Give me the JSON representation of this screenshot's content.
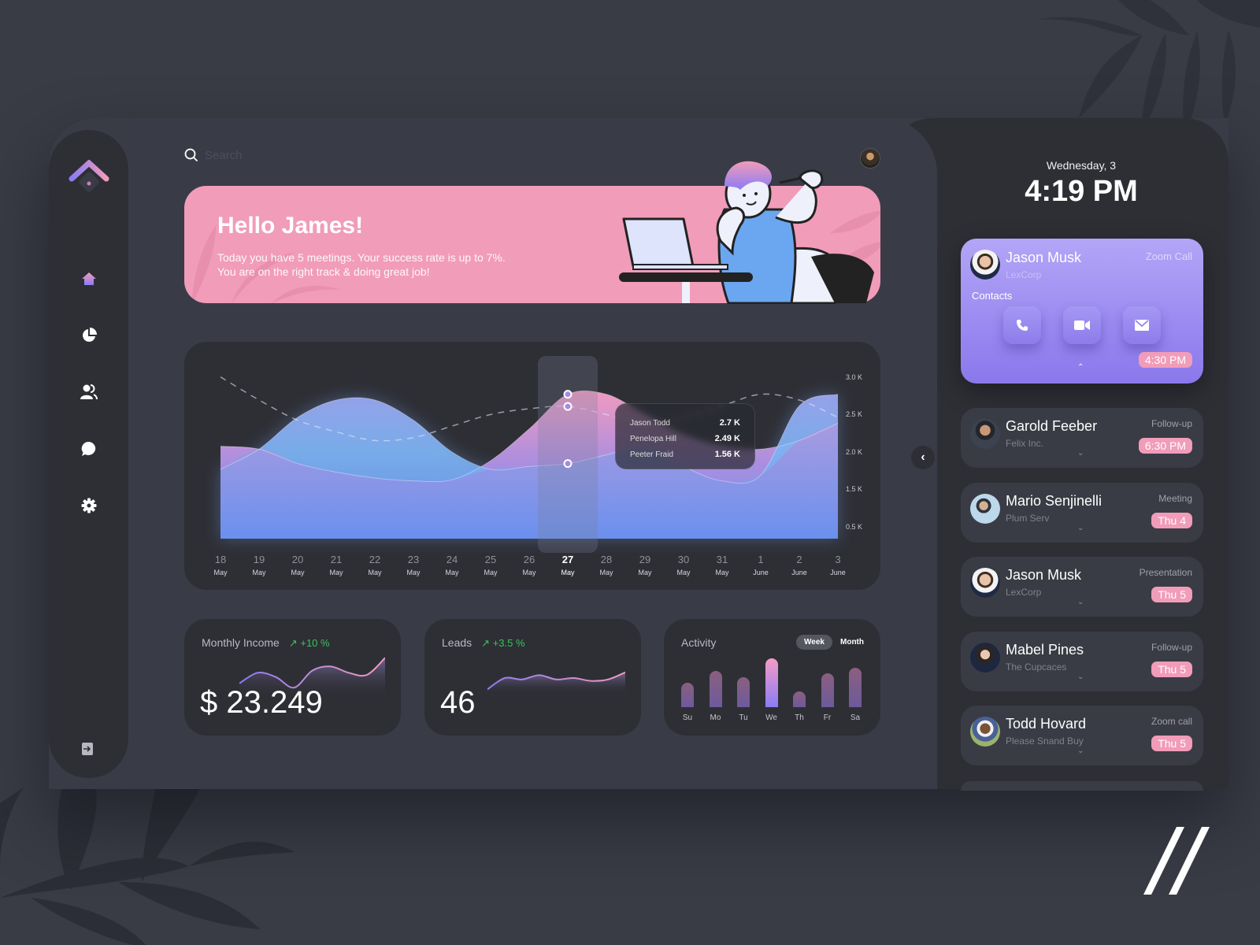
{
  "search": {
    "placeholder": "Search",
    "value": ""
  },
  "sidebar": {
    "items": [
      {
        "name": "home",
        "active": true
      },
      {
        "name": "analytics"
      },
      {
        "name": "contacts"
      },
      {
        "name": "messages"
      },
      {
        "name": "settings"
      }
    ],
    "logout": "logout"
  },
  "hero": {
    "title": "Hello James!",
    "line1": "Today you have 5 meetings. Your success rate is up to 7%.",
    "line2": "You are on the right track & doing great job!"
  },
  "chart_data": {
    "type": "area",
    "title": "",
    "xlabel": "",
    "ylabel": "",
    "ylim": [
      0,
      3.2
    ],
    "y_ticks": [
      "3.0 K",
      "2.5 K",
      "2.0 K",
      "1.5 K",
      "0.5 K"
    ],
    "y_tick_values": [
      3.0,
      2.5,
      2.0,
      1.5,
      0.5
    ],
    "categories": [
      {
        "day": "18",
        "month": "May"
      },
      {
        "day": "19",
        "month": "May"
      },
      {
        "day": "20",
        "month": "May"
      },
      {
        "day": "21",
        "month": "May"
      },
      {
        "day": "22",
        "month": "May"
      },
      {
        "day": "23",
        "month": "May"
      },
      {
        "day": "24",
        "month": "May"
      },
      {
        "day": "25",
        "month": "May"
      },
      {
        "day": "26",
        "month": "May"
      },
      {
        "day": "27",
        "month": "May"
      },
      {
        "day": "28",
        "month": "May"
      },
      {
        "day": "29",
        "month": "May"
      },
      {
        "day": "30",
        "month": "May"
      },
      {
        "day": "31",
        "month": "May"
      },
      {
        "day": "1",
        "month": "June"
      },
      {
        "day": "2",
        "month": "June"
      },
      {
        "day": "3",
        "month": "June"
      }
    ],
    "highlight_index": 9,
    "series": [
      {
        "name": "Jason Todd",
        "color": "#ef94bd",
        "values": [
          1.8,
          1.75,
          1.5,
          1.35,
          1.25,
          1.2,
          1.22,
          1.55,
          2.1,
          2.7,
          2.7,
          2.35,
          2.0,
          1.8,
          1.75,
          1.9,
          2.2
        ]
      },
      {
        "name": "Penelopa Hill",
        "color": "#7fb2f5",
        "values": [
          1.4,
          1.75,
          2.3,
          2.6,
          2.6,
          2.25,
          1.7,
          1.4,
          1.45,
          1.5,
          1.65,
          1.8,
          1.45,
          1.2,
          1.3,
          2.5,
          2.7
        ]
      },
      {
        "name": "Peeter Fraid",
        "type": "dashed",
        "values": [
          3.0,
          2.6,
          2.25,
          2.05,
          1.9,
          1.95,
          2.15,
          2.35,
          2.45,
          2.49,
          2.35,
          2.2,
          2.3,
          2.5,
          2.7,
          2.6,
          2.3
        ]
      }
    ],
    "tooltip": [
      {
        "name": "Jason Todd",
        "value": "2.7 K"
      },
      {
        "name": "Penelopa Hill",
        "value": "2.49 K"
      },
      {
        "name": "Peeter Fraid",
        "value": "1.56 K"
      }
    ]
  },
  "stats": {
    "income": {
      "label": "Monthly Income",
      "delta": "+10 %",
      "value": "$ 23.249",
      "trend": [
        0.3,
        0.55,
        0.45,
        0.2,
        0.6,
        0.7,
        0.55,
        0.5,
        0.9
      ]
    },
    "leads": {
      "label": "Leads",
      "delta": "+3.5 %",
      "value": "46",
      "trend": [
        0.1,
        0.5,
        0.45,
        0.6,
        0.45,
        0.5,
        0.4,
        0.45,
        0.7
      ]
    }
  },
  "activity": {
    "title": "Activity",
    "toggle": {
      "week": "Week",
      "month": "Month",
      "selected": "Week"
    },
    "days": [
      "Su",
      "Mo",
      "Tu",
      "We",
      "Th",
      "Fr",
      "Sa"
    ],
    "values": [
      0.5,
      0.75,
      0.62,
      1.0,
      0.32,
      0.7,
      0.8
    ],
    "highlight_index": 3
  },
  "clock": {
    "date": "Wednesday, 3",
    "time": "4:19 PM"
  },
  "featured": {
    "name": "Jason Musk",
    "company": "LexCorp",
    "type": "Zoom Call",
    "contacts_label": "Contacts",
    "time": "4:30 PM",
    "actions": [
      "phone",
      "video",
      "mail"
    ]
  },
  "appointments": [
    {
      "name": "Garold Feeber",
      "company": "Felix Inc.",
      "type": "Follow-up",
      "when": "6:30 PM"
    },
    {
      "name": "Mario Senjinelli",
      "company": "Plum Serv",
      "type": "Meeting",
      "when": "Thu 4"
    },
    {
      "name": "Jason Musk",
      "company": "LexCorp",
      "type": "Presentation",
      "when": "Thu 5"
    },
    {
      "name": "Mabel Pines",
      "company": "The Cupcaces",
      "type": "Follow-up",
      "when": "Thu 5"
    },
    {
      "name": "Todd Hovard",
      "company": "Please Snand Buy",
      "type": "Zoom call",
      "when": "Thu 5"
    }
  ]
}
